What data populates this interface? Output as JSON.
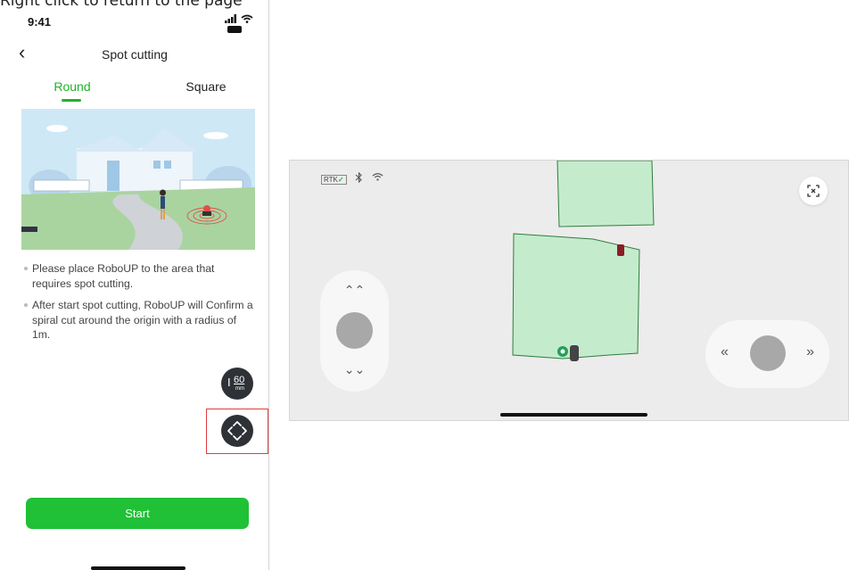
{
  "caption": "Right click to return to the page",
  "phone": {
    "status": {
      "time": "9:41"
    },
    "header": {
      "back": "‹",
      "title": "Spot cutting"
    },
    "tabs": [
      {
        "label": "Round",
        "active": true
      },
      {
        "label": "Square",
        "active": false
      }
    ],
    "instructions": [
      "Please place RoboUP to the area that requires spot cutting.",
      "After start spot cutting, RoboUP will Confirm a spiral cut around the origin with a radius of 1m."
    ],
    "cut_height": {
      "value": "60",
      "unit": "mm",
      "icon": "cut-height-icon"
    },
    "direction_button": {
      "icon": "direction-arrows-icon"
    },
    "start_button": "Start"
  },
  "map_view": {
    "rtk_label": "RTK",
    "rtk_status": "✓",
    "icons": [
      "bluetooth-icon",
      "wifi-icon",
      "expand-icon"
    ],
    "vertical_joystick": {
      "up": "⌃⌃",
      "down": "⌄⌄"
    },
    "horizontal_joystick": {
      "left": "«",
      "right": "»"
    },
    "colors": {
      "zone_fill": "#c5ebcd",
      "zone_stroke": "#2f7d3c",
      "accent": "#20c136"
    }
  }
}
